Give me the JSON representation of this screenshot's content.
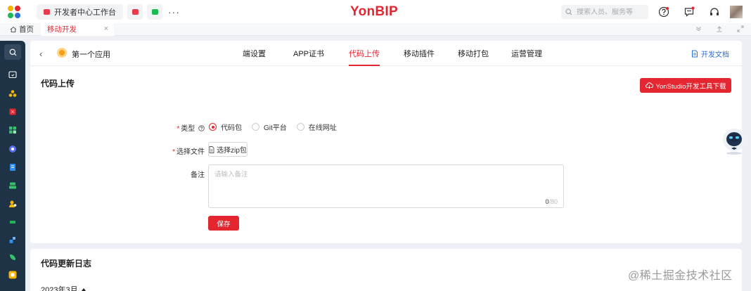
{
  "topbar": {
    "workbench_tab": "开发者中心工作台",
    "more": "···",
    "brand": "YonBIP",
    "search_placeholder": "搜索人员、服务等"
  },
  "tabbar": {
    "home": "首页",
    "active_tab": "移动开发",
    "close": "×"
  },
  "header": {
    "back": "‹",
    "app_name": "第一个应用",
    "nav": [
      "端设置",
      "APP证书",
      "代码上传",
      "移动插件",
      "移动打包",
      "运营管理"
    ],
    "active_nav": "代码上传",
    "doc_link": "开发文档"
  },
  "upload": {
    "title": "代码上传",
    "download_button": "YonStudio开发工具下载",
    "type_label": "类型",
    "type_options": [
      "代码包",
      "Git平台",
      "在线网址"
    ],
    "selected_type": "代码包",
    "file_label": "选择文件",
    "file_button": "选择zip包",
    "remark_label": "备注",
    "remark_placeholder": "请输入备注",
    "remark_count": "0",
    "remark_max": "/80",
    "save_button": "保存"
  },
  "log": {
    "title": "代码更新日志",
    "month": "2023年3月"
  },
  "watermark": "@稀土掘金技术社区",
  "colors": {
    "accent": "#e3262f",
    "sidebar": "#1e3346",
    "link": "#2b6fd6"
  },
  "icons": {
    "sidebar": [
      "search-icon",
      "folder-icon",
      "cluster-icon",
      "red-square-icon",
      "grid-icon",
      "circle-icon",
      "doc-icon",
      "layers-icon",
      "user-icon",
      "green-icon",
      "blue-icon",
      "leaf-icon",
      "yellow-icon"
    ]
  }
}
